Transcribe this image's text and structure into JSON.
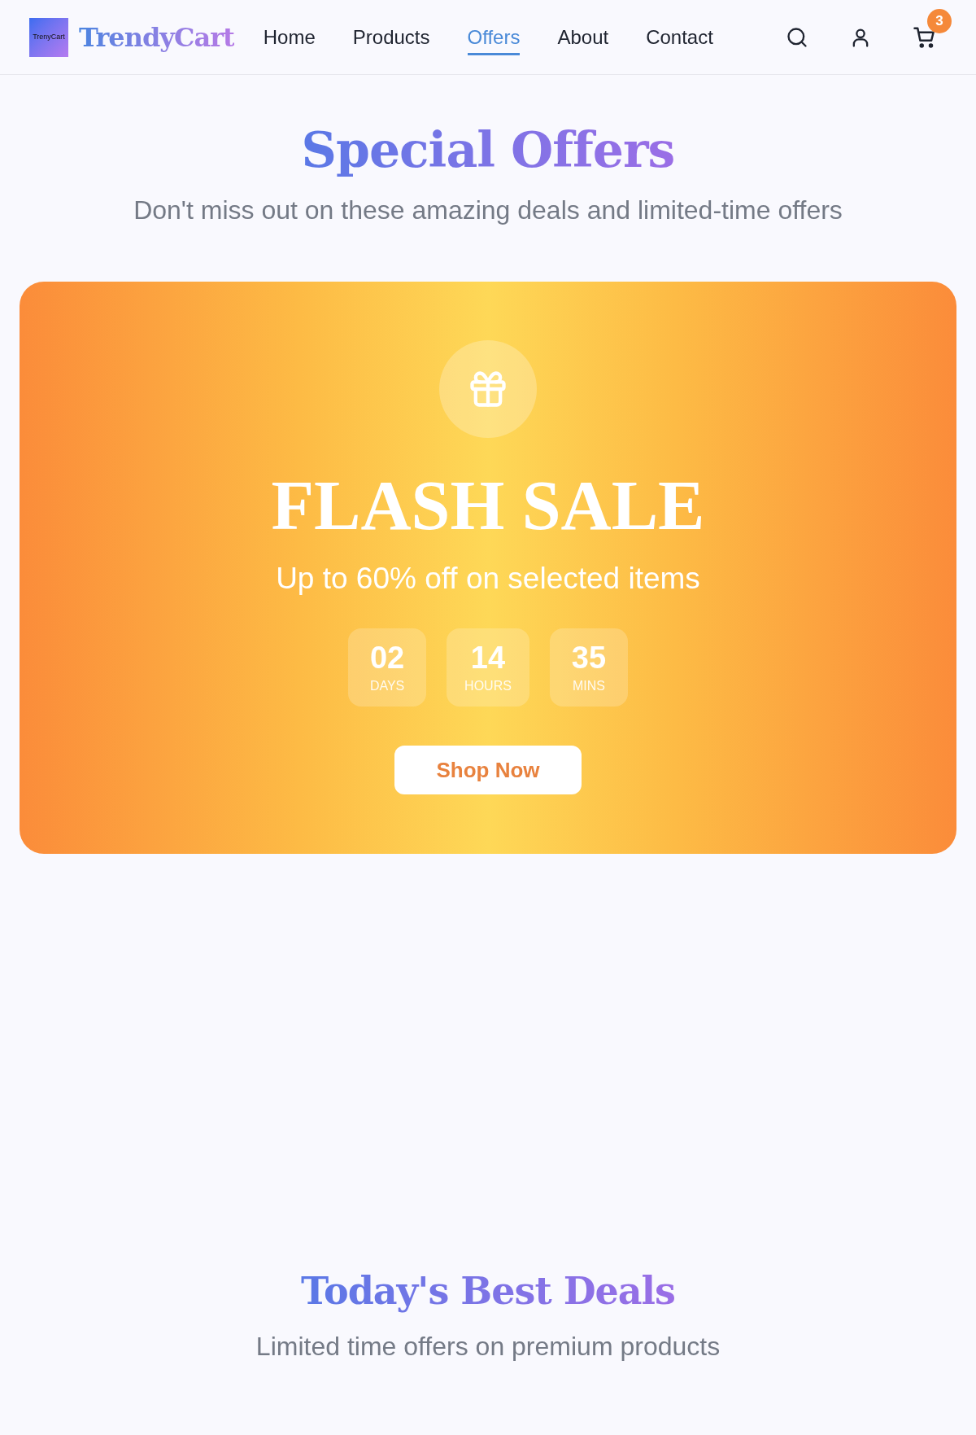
{
  "header": {
    "logo_text": "TrenyCart",
    "brand": "TrendyCart",
    "nav": [
      {
        "label": "Home",
        "selected": false
      },
      {
        "label": "Products",
        "selected": false
      },
      {
        "label": "Offers",
        "selected": true
      },
      {
        "label": "About",
        "selected": false
      },
      {
        "label": "Contact",
        "selected": false
      }
    ],
    "cart_count": "3"
  },
  "hero": {
    "title": "Special Offers",
    "subtitle": "Don't miss out on these amazing deals and limited-time offers"
  },
  "flash_sale": {
    "title": "FLASH SALE",
    "subtitle": "Up to 60% off on selected items",
    "countdown": [
      {
        "value": "02",
        "unit": "DAYS"
      },
      {
        "value": "14",
        "unit": "HOURS"
      },
      {
        "value": "35",
        "unit": "MINS"
      }
    ],
    "button": "Shop Now"
  },
  "best_deals": {
    "title": "Today's Best Deals",
    "subtitle": "Limited time offers on premium products"
  }
}
